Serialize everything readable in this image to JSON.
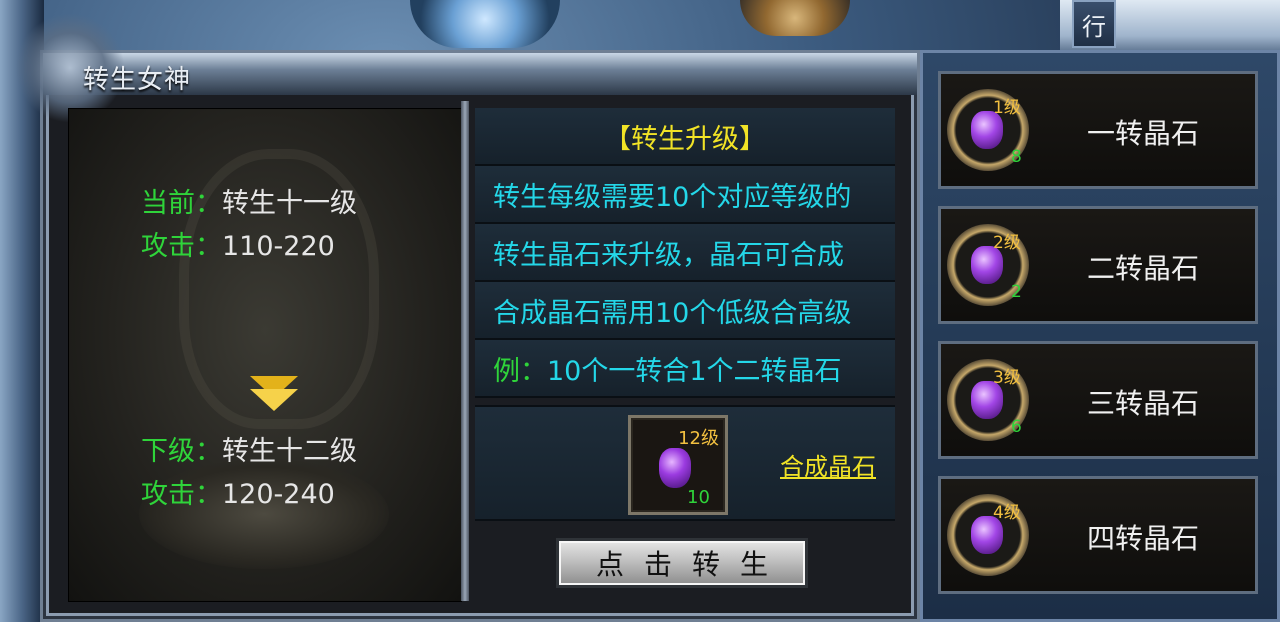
{
  "window": {
    "title": "转生女神"
  },
  "side_tab": {
    "label": "行"
  },
  "current": {
    "level_key": "当前：",
    "level_val": "转生十一级",
    "attack_key": "攻击：",
    "attack_val": "110-220"
  },
  "next": {
    "level_key": "下级：",
    "level_val": "转生十二级",
    "attack_key": "攻击：",
    "attack_val": "120-240"
  },
  "info": {
    "title": "【转生升级】",
    "line1": "转生每级需要10个对应等级的",
    "line2": "转生晶石来升级，晶石可合成",
    "line3": "合成晶石需用10个低级合高级",
    "line4_key": "例：",
    "line4_val": "10个一转合1个二转晶石"
  },
  "combine": {
    "slot_level": "12级",
    "slot_count": "10",
    "link": "合成晶石"
  },
  "rebirth_button": "点击转生",
  "gems": [
    {
      "level": "1级",
      "count": "8",
      "name": "一转晶石"
    },
    {
      "level": "2级",
      "count": "2",
      "name": "二转晶石"
    },
    {
      "level": "3级",
      "count": "6",
      "name": "三转晶石"
    },
    {
      "level": "4级",
      "count": "",
      "name": "四转晶石"
    }
  ],
  "colors": {
    "green": "#2fd43a",
    "cyan": "#24d7e8",
    "yellow": "#f1e326",
    "gold": "#f2c040"
  }
}
